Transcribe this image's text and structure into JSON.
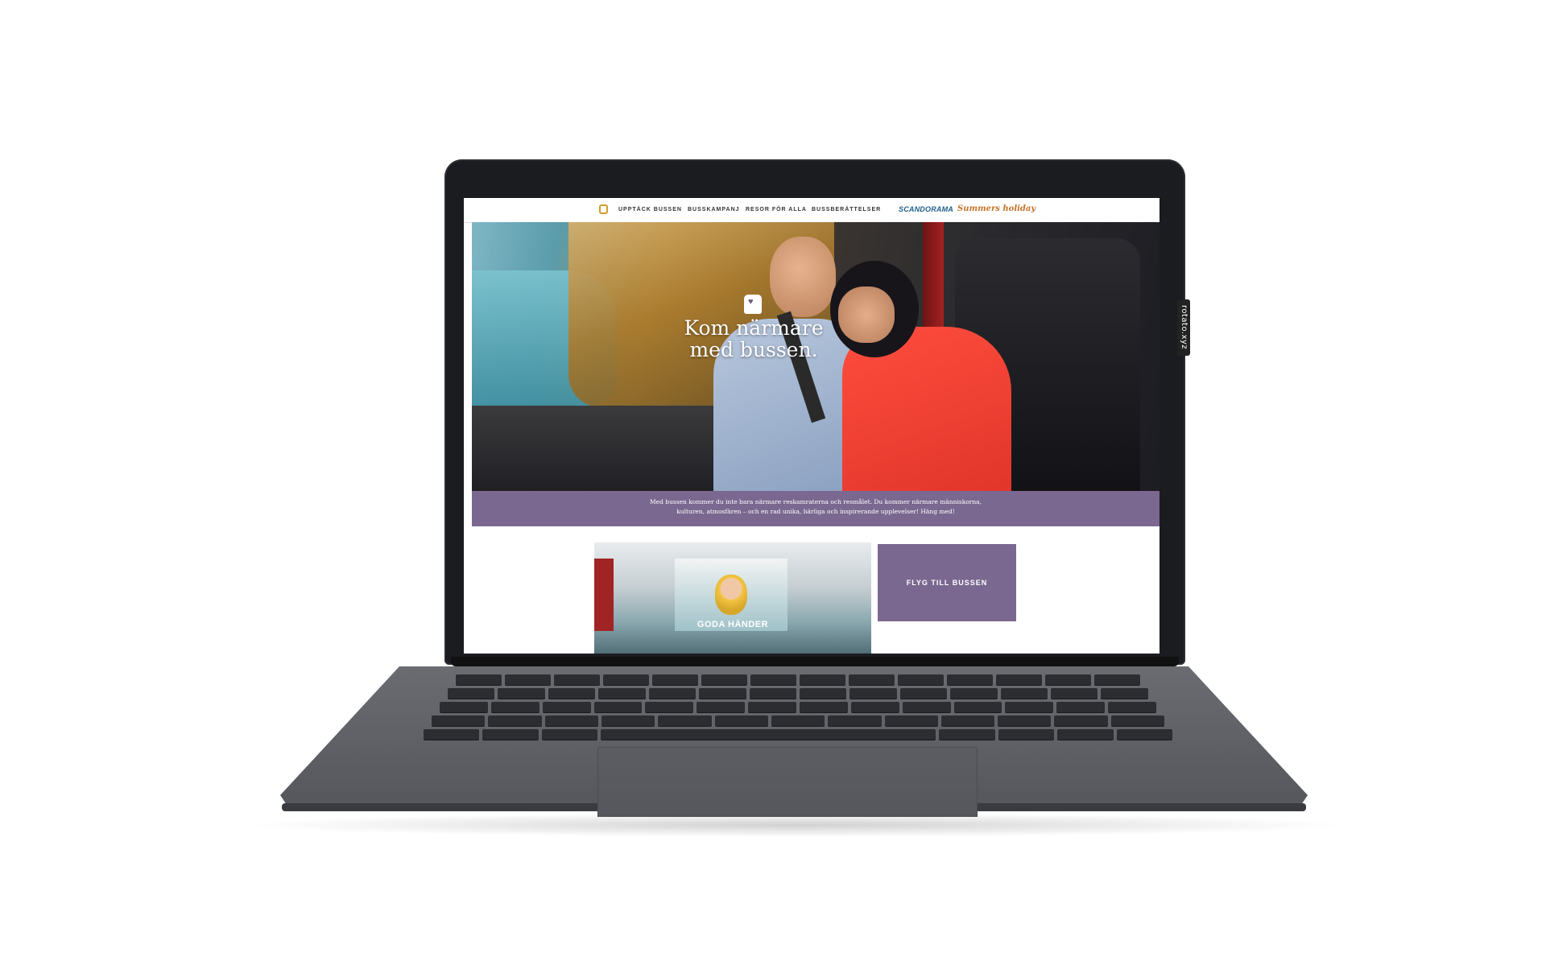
{
  "device": {
    "side_tag": "rotato.xyz"
  },
  "nav": {
    "links": [
      "UPPTÄCK BUSSEN",
      "BUSSKAMPANJ",
      "RESOR FÖR ALLA",
      "BUSSBERÄTTELSER"
    ],
    "brand1": "SCANDORAMA",
    "brand2": "Summers holiday"
  },
  "hero": {
    "headline_line1": "Kom närmare",
    "headline_line2": "med bussen."
  },
  "intro": {
    "line1": "Med bussen kommer du inte bara närmare reskamraterna och resmålet. Du kommer närmare människorna,",
    "line2": "kulturen, atmosfären – och en rad unika, härliga och inspirerande upplevelser! Häng med!"
  },
  "cards": {
    "photo_label": "GODA HÄNDER",
    "purple_label": "FLYG TILL BUSSEN"
  },
  "colors": {
    "accent_purple": "#7a6890",
    "bus_logo": "#d39b2a",
    "brand1": "#1f5e8a",
    "brand2": "#c4722a"
  }
}
